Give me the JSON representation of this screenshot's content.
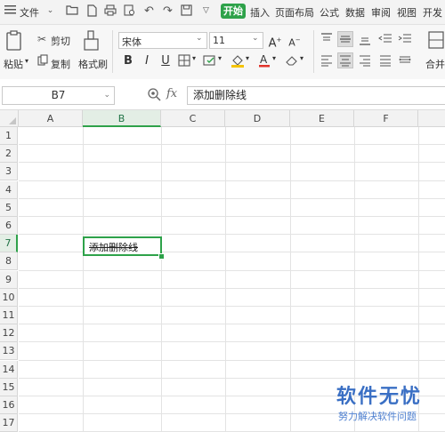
{
  "menubar": {
    "file_label": "文件",
    "start_label": "开始",
    "tabs": [
      "插入",
      "页面布局",
      "公式",
      "数据",
      "审阅",
      "视图",
      "开发"
    ]
  },
  "ribbon": {
    "paste_label": "粘贴",
    "cut_label": "剪切",
    "copy_label": "复制",
    "format_painter_label": "格式刷",
    "font_name": "宋体",
    "font_size": "11",
    "merge_label": "合并"
  },
  "formula_bar": {
    "cell_ref": "B7",
    "fx_label": "fx",
    "content": "添加删除线"
  },
  "grid": {
    "columns": [
      "A",
      "B",
      "C",
      "D",
      "E",
      "F"
    ],
    "rows": [
      "1",
      "2",
      "3",
      "4",
      "5",
      "6",
      "7",
      "8",
      "9",
      "10",
      "11",
      "12",
      "13",
      "14",
      "15",
      "16",
      "17"
    ],
    "selected_column": "B",
    "selected_row": "7",
    "active_cell_text": "添加删除线"
  },
  "watermark": {
    "title": "软件无忧",
    "subtitle": "努力解决软件问题"
  },
  "colors": {
    "accent": "#2ea24a",
    "watermark": "#3a6fc4"
  }
}
